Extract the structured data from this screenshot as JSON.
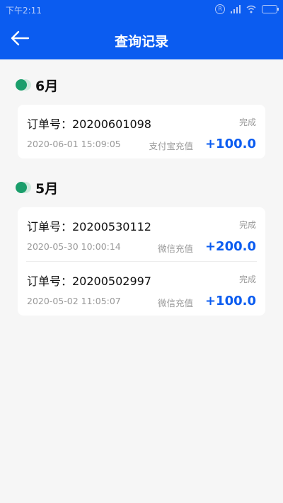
{
  "status_bar": {
    "time": "下午2:11",
    "r_badge": "R"
  },
  "nav": {
    "title": "查询记录",
    "back_icon": "arrow-left-icon"
  },
  "sections": [
    {
      "month": "6月",
      "orders": [
        {
          "order_no": "订单号：20200601098",
          "status": "完成",
          "datetime": "2020-06-01 15:09:05",
          "method": "支付宝充值",
          "amount": "+100.0"
        }
      ]
    },
    {
      "month": "5月",
      "orders": [
        {
          "order_no": "订单号：20200530112",
          "status": "完成",
          "datetime": "2020-05-30 10:00:14",
          "method": "微信充值",
          "amount": "+200.0"
        },
        {
          "order_no": "订单号：20200502997",
          "status": "完成",
          "datetime": "2020-05-02 11:05:07",
          "method": "微信充值",
          "amount": "+100.0"
        }
      ]
    }
  ],
  "colors": {
    "primary": "#0b5cf0",
    "dot": "#1a9e6b",
    "muted": "#999999"
  }
}
